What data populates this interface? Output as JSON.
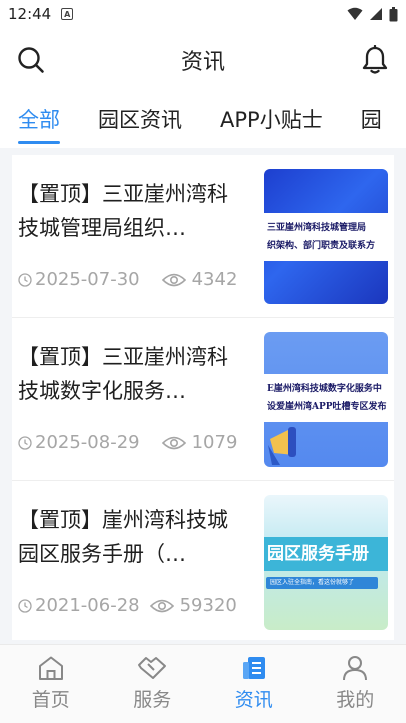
{
  "status_bar": {
    "time": "12:44",
    "notification_icon": "a-box-icon",
    "wifi_icon": "wifi-icon",
    "signal_icon": "signal-icon",
    "battery_icon": "battery-icon"
  },
  "header": {
    "title": "资讯",
    "search_icon": "search-icon",
    "bell_icon": "bell-icon"
  },
  "tabs": [
    {
      "label": "全部",
      "active": true
    },
    {
      "label": "园区资讯",
      "active": false
    },
    {
      "label": "APP小贴士",
      "active": false
    },
    {
      "label": "园",
      "active": false
    }
  ],
  "articles": [
    {
      "title": "【置顶】三亚崖州湾科技城管理局组织…",
      "date": "2025-07-30",
      "views": "4342",
      "thumb_lines": [
        "三亚崖州湾科技城管理局",
        "织架构、部门职责及联系方"
      ]
    },
    {
      "title": "【置顶】三亚崖州湾科技城数字化服务…",
      "date": "2025-08-29",
      "views": "1079",
      "thumb_lines": [
        "E崖州湾科技城数字化服务中",
        "设爱崖州湾APP吐槽专区发布"
      ]
    },
    {
      "title": "【置顶】崖州湾科技城园区服务手册（…",
      "date": "2021-06-28",
      "views": "59320",
      "thumb_title": "园区服务手册",
      "thumb_sub": "园区入驻全指南，看这份就够了"
    }
  ],
  "bottom_nav": [
    {
      "label": "首页",
      "icon": "home-icon",
      "active": false
    },
    {
      "label": "服务",
      "icon": "handshake-icon",
      "active": false
    },
    {
      "label": "资讯",
      "icon": "news-icon",
      "active": true
    },
    {
      "label": "我的",
      "icon": "user-icon",
      "active": false
    }
  ],
  "colors": {
    "accent": "#2f8cf0",
    "meta_gray": "#a6a6a6",
    "background": "#f3f5f8"
  }
}
